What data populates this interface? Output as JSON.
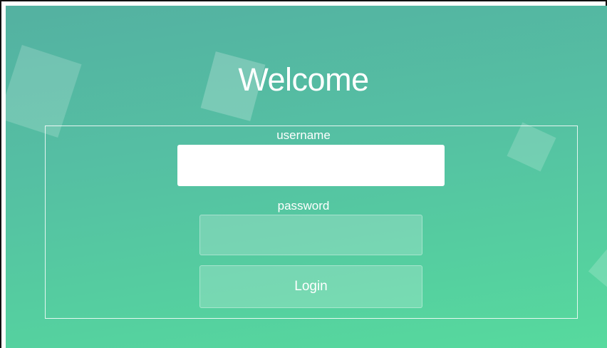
{
  "page": {
    "title": "Welcome",
    "accent_gradient": [
      "#54b1a1",
      "#57da9e"
    ]
  },
  "form": {
    "username_label": "username",
    "username_value": "",
    "password_label": "password",
    "password_value": "",
    "login_label": "Login"
  }
}
